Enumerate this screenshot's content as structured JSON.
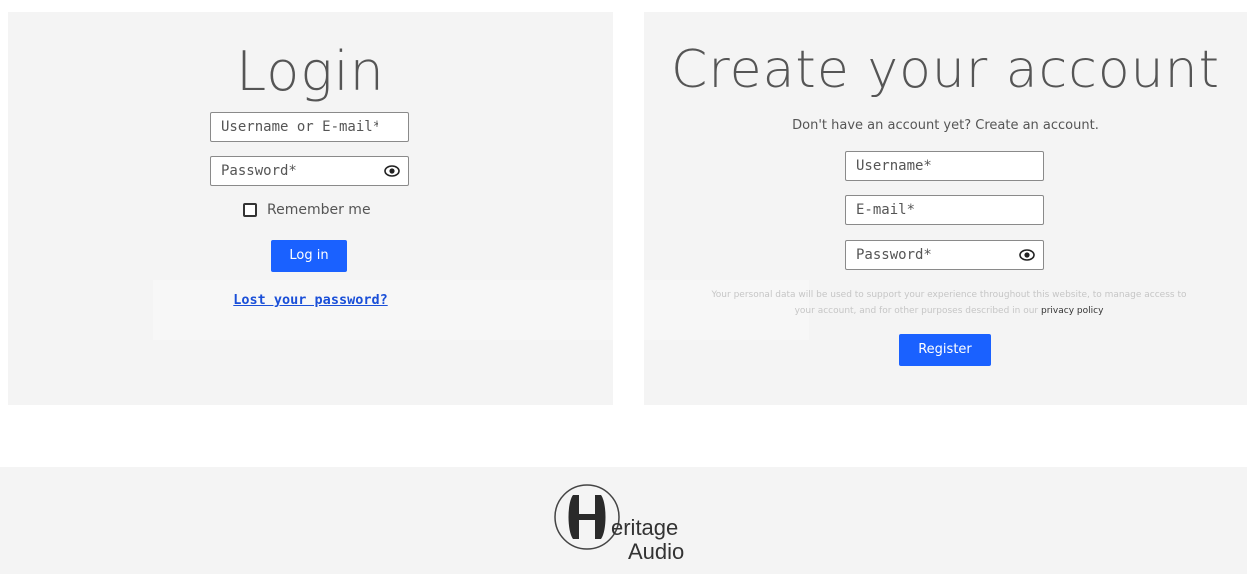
{
  "login": {
    "title": "Login",
    "username_placeholder": "Username or E-mail*",
    "password_placeholder": "Password*",
    "remember_label": "Remember me",
    "login_button": "Log in",
    "lost_password_link": "Lost your password?"
  },
  "register": {
    "title": "Create your account",
    "intro": "Don't have an account yet? Create an account.",
    "username_placeholder": "Username*",
    "email_placeholder": "E-mail*",
    "password_placeholder": "Password*",
    "privacy_text": "Your personal data will be used to support your experience throughout this website, to manage access to your account, and for other purposes described in our",
    "privacy_link": "privacy policy",
    "register_button": "Register"
  },
  "footer": {
    "logo_line1": "eritage",
    "logo_line2": "Audio"
  },
  "colors": {
    "accent": "#1a61ff",
    "panel_background": "#f4f4f4",
    "link": "#1a4fd8"
  },
  "icons": {
    "password_toggle": "eye-icon",
    "logo": "heritage-audio-logo"
  }
}
